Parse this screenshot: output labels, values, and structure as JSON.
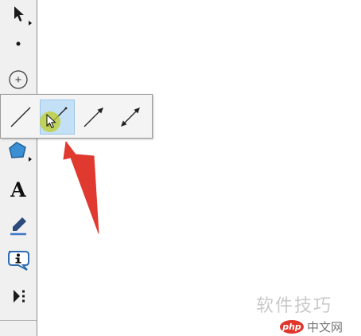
{
  "toolbar": {
    "tools": [
      {
        "id": "arrow",
        "icon": "arrow-select-icon"
      },
      {
        "id": "point",
        "icon": "point-icon"
      },
      {
        "id": "compass",
        "icon": "compass-circle-icon"
      },
      {
        "id": "segment",
        "icon": "segment-icon"
      },
      {
        "id": "polygon",
        "icon": "polygon-icon"
      },
      {
        "id": "text",
        "icon": "text-icon",
        "label": "A"
      },
      {
        "id": "marker",
        "icon": "marker-pen-icon"
      },
      {
        "id": "info",
        "icon": "info-icon"
      },
      {
        "id": "custom",
        "icon": "custom-tool-icon"
      }
    ]
  },
  "palette": {
    "items": [
      {
        "id": "line-plain",
        "icon": "straight-line-icon"
      },
      {
        "id": "segment",
        "icon": "segment-tool-icon",
        "selected": true
      },
      {
        "id": "ray",
        "icon": "ray-icon"
      },
      {
        "id": "line",
        "icon": "double-arrow-line-icon"
      }
    ]
  },
  "annotation": {
    "color": "#e0392f"
  },
  "accent": {
    "selected_bg": "#c4e0f6",
    "cursor_glow": "#bece28"
  },
  "watermark": {
    "top_text": "软件技巧",
    "logo_text": "php",
    "site_text": "中文网"
  }
}
